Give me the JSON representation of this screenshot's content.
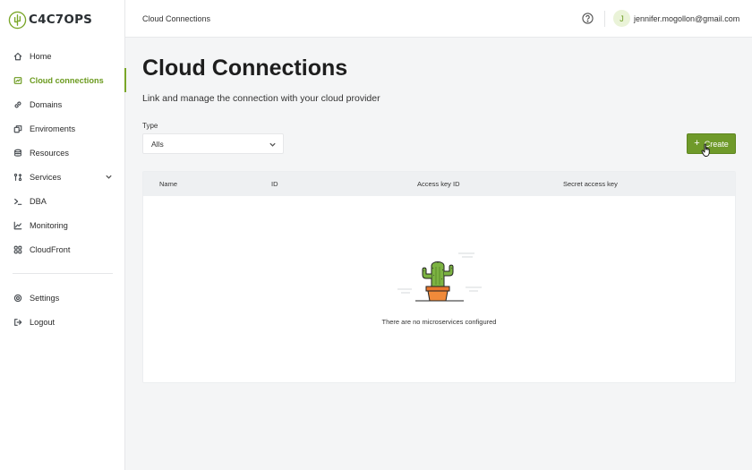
{
  "brand": {
    "name": "C4C7OPS",
    "accent": "#7aa629"
  },
  "sidebar": {
    "items": [
      {
        "label": "Home",
        "icon": "home-icon"
      },
      {
        "label": "Cloud connections",
        "icon": "cloud-connection-icon",
        "active": true
      },
      {
        "label": "Domains",
        "icon": "link-icon"
      },
      {
        "label": "Enviroments",
        "icon": "environments-icon"
      },
      {
        "label": "Resources",
        "icon": "database-icon"
      },
      {
        "label": "Services",
        "icon": "services-icon",
        "expandable": true
      },
      {
        "label": "DBA",
        "icon": "terminal-icon"
      },
      {
        "label": "Monitoring",
        "icon": "chart-line-icon"
      },
      {
        "label": "CloudFront",
        "icon": "cloudfront-icon"
      }
    ],
    "bottom": [
      {
        "label": "Settings",
        "icon": "gear-icon"
      },
      {
        "label": "Logout",
        "icon": "logout-icon"
      }
    ]
  },
  "topbar": {
    "breadcrumb": "Cloud Connections",
    "user_initial": "J",
    "user_email": "jennifer.mogollon@gmail.com"
  },
  "main": {
    "title": "Cloud Connections",
    "subtitle": "Link and manage the connection with your cloud provider",
    "filter": {
      "label": "Type",
      "value": "Alls"
    },
    "create_label": "Create",
    "table": {
      "columns": [
        "Name",
        "ID",
        "Access key ID",
        "Secret access key"
      ],
      "rows": []
    },
    "empty_message": "There are no microservices configured"
  }
}
